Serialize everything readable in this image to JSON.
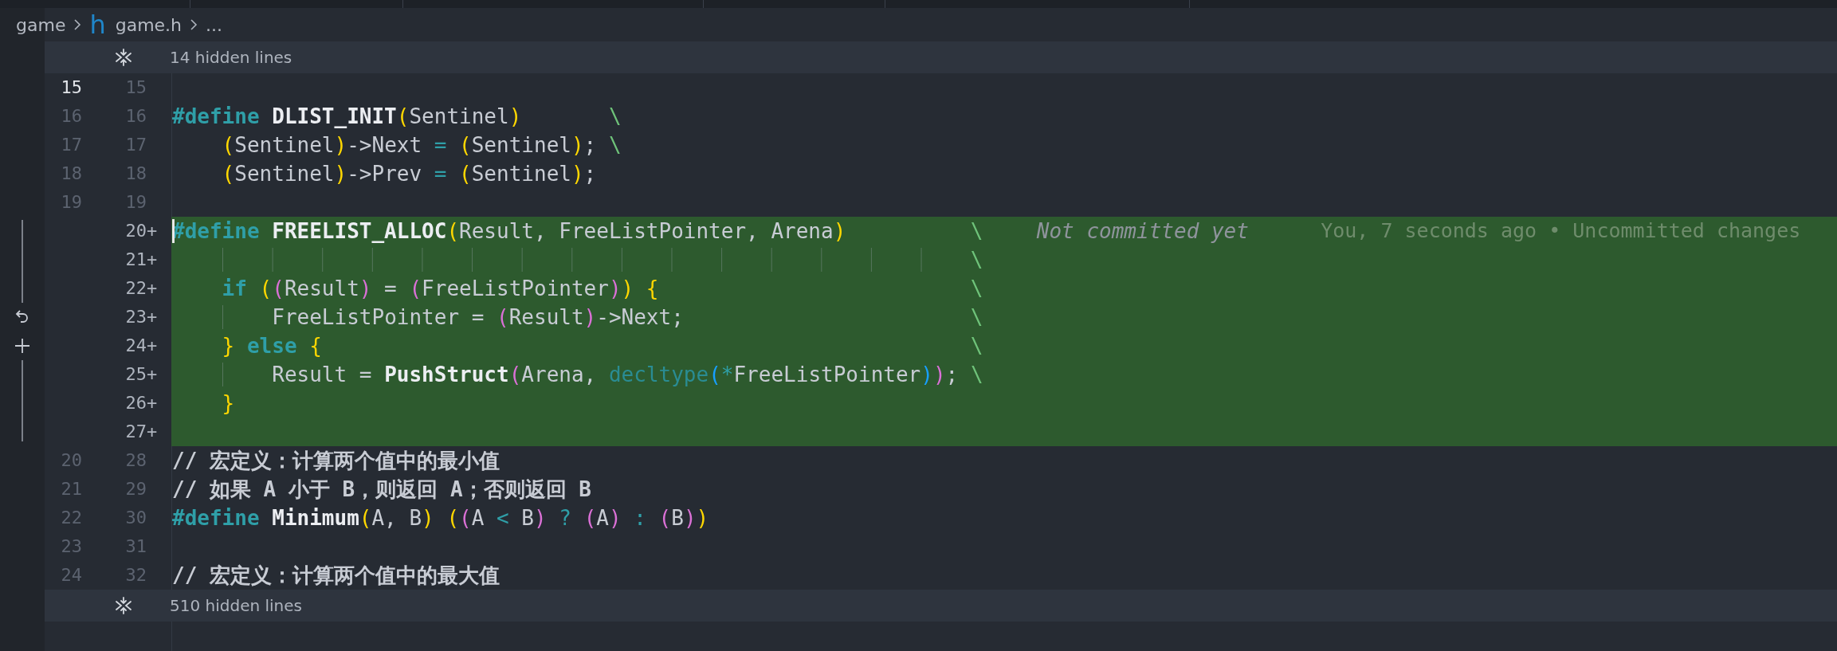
{
  "breadcrumb": {
    "items": [
      {
        "kind": "folder",
        "label": "game"
      },
      {
        "kind": "file",
        "icon": "h",
        "label": "game.h"
      },
      {
        "kind": "more",
        "label": "..."
      }
    ]
  },
  "editor": {
    "rows": [
      {
        "kind": "fold",
        "label": "14 hidden lines"
      },
      {
        "kind": "line",
        "old": "15",
        "new": "15",
        "active": true,
        "added": false,
        "tokens": []
      },
      {
        "kind": "line",
        "old": "16",
        "new": "16",
        "active": false,
        "added": false,
        "tokens": [
          {
            "kind": "kw",
            "text": "#define "
          },
          {
            "kind": "macro",
            "text": "DLIST_INIT"
          },
          {
            "kind": "b1",
            "text": "("
          },
          {
            "kind": "text",
            "text": "Sentinel"
          },
          {
            "kind": "b1",
            "text": ")"
          },
          {
            "kind": "cont",
            "text": "       \\"
          }
        ]
      },
      {
        "kind": "line",
        "old": "17",
        "new": "17",
        "active": false,
        "added": false,
        "tokens": [
          {
            "kind": "b1",
            "text": "    ("
          },
          {
            "kind": "text",
            "text": "Sentinel"
          },
          {
            "kind": "b1",
            "text": ")"
          },
          {
            "kind": "text",
            "text": "->Next "
          },
          {
            "kind": "op",
            "text": "= "
          },
          {
            "kind": "b1",
            "text": "("
          },
          {
            "kind": "text",
            "text": "Sentinel"
          },
          {
            "kind": "b1",
            "text": ")"
          },
          {
            "kind": "text",
            "text": "; "
          },
          {
            "kind": "cont",
            "text": "\\"
          }
        ]
      },
      {
        "kind": "line",
        "old": "18",
        "new": "18",
        "active": false,
        "added": false,
        "tokens": [
          {
            "kind": "b1",
            "text": "    ("
          },
          {
            "kind": "text",
            "text": "Sentinel"
          },
          {
            "kind": "b1",
            "text": ")"
          },
          {
            "kind": "text",
            "text": "->Prev "
          },
          {
            "kind": "op",
            "text": "= "
          },
          {
            "kind": "b1",
            "text": "("
          },
          {
            "kind": "text",
            "text": "Sentinel"
          },
          {
            "kind": "b1",
            "text": ")"
          },
          {
            "kind": "text",
            "text": ";"
          }
        ]
      },
      {
        "kind": "line",
        "old": "19",
        "new": "19",
        "active": false,
        "added": false,
        "tokens": []
      },
      {
        "kind": "line",
        "new": "20",
        "marker": "+",
        "added": true,
        "cursor": true,
        "tokens": [
          {
            "kind": "kw",
            "text": "#define "
          },
          {
            "kind": "macro",
            "text": "FREELIST_ALLOC"
          },
          {
            "kind": "b1",
            "text": "("
          },
          {
            "kind": "text",
            "text": "Result, FreeListPointer, Arena"
          },
          {
            "kind": "b1",
            "text": ")"
          },
          {
            "kind": "cont",
            "text": "          \\"
          }
        ],
        "blame": {
          "message": "Not committed yet",
          "detail": "You, 7 seconds ago • Uncommitted changes"
        }
      },
      {
        "kind": "line",
        "new": "21",
        "marker": "+",
        "added": true,
        "tokens": [
          {
            "kind": "cont",
            "text": "                                                                \\"
          }
        ]
      },
      {
        "kind": "line",
        "new": "22",
        "marker": "+",
        "added": true,
        "tokens": [
          {
            "kind": "kw",
            "text": "    if "
          },
          {
            "kind": "b1",
            "text": "("
          },
          {
            "kind": "b2",
            "text": "("
          },
          {
            "kind": "text",
            "text": "Result"
          },
          {
            "kind": "b2",
            "text": ")"
          },
          {
            "kind": "text",
            "text": " = "
          },
          {
            "kind": "b2",
            "text": "("
          },
          {
            "kind": "text",
            "text": "FreeListPointer"
          },
          {
            "kind": "b2",
            "text": ")"
          },
          {
            "kind": "b1",
            "text": ") {"
          },
          {
            "kind": "cont",
            "text": "                         \\"
          }
        ]
      },
      {
        "kind": "line",
        "new": "23",
        "marker": "+",
        "added": true,
        "tokens": [
          {
            "kind": "text",
            "text": "        FreeListPointer = "
          },
          {
            "kind": "b2",
            "text": "("
          },
          {
            "kind": "text",
            "text": "Result"
          },
          {
            "kind": "b2",
            "text": ")"
          },
          {
            "kind": "text",
            "text": "->Next;"
          },
          {
            "kind": "cont",
            "text": "                       \\"
          }
        ]
      },
      {
        "kind": "line",
        "new": "24",
        "marker": "+",
        "added": true,
        "tokens": [
          {
            "kind": "b1",
            "text": "    } "
          },
          {
            "kind": "kw",
            "text": "else "
          },
          {
            "kind": "b1",
            "text": "{"
          },
          {
            "kind": "cont",
            "text": "                                                    \\"
          }
        ]
      },
      {
        "kind": "line",
        "new": "25",
        "marker": "+",
        "added": true,
        "tokens": [
          {
            "kind": "text",
            "text": "        Result = "
          },
          {
            "kind": "macro",
            "text": "PushStruct"
          },
          {
            "kind": "b2",
            "text": "("
          },
          {
            "kind": "text",
            "text": "Arena, "
          },
          {
            "kind": "type",
            "text": "decltype"
          },
          {
            "kind": "b3",
            "text": "("
          },
          {
            "kind": "op",
            "text": "*"
          },
          {
            "kind": "text",
            "text": "FreeListPointer"
          },
          {
            "kind": "b3",
            "text": ")"
          },
          {
            "kind": "b2",
            "text": ")"
          },
          {
            "kind": "text",
            "text": "; "
          },
          {
            "kind": "cont",
            "text": "\\"
          }
        ]
      },
      {
        "kind": "line",
        "new": "26",
        "marker": "+",
        "added": true,
        "tokens": [
          {
            "kind": "b1",
            "text": "    }"
          }
        ]
      },
      {
        "kind": "line",
        "new": "27",
        "marker": "+",
        "added": true,
        "tokens": []
      },
      {
        "kind": "line",
        "old": "20",
        "new": "28",
        "active": false,
        "added": false,
        "tokens": [
          {
            "kind": "comment",
            "text": "// 宏定义：计算两个值中的最小值"
          }
        ]
      },
      {
        "kind": "line",
        "old": "21",
        "new": "29",
        "active": false,
        "added": false,
        "tokens": [
          {
            "kind": "comment",
            "text": "// 如果 A 小于 B，则返回 A；否则返回 B"
          }
        ]
      },
      {
        "kind": "line",
        "old": "22",
        "new": "30",
        "active": false,
        "added": false,
        "tokens": [
          {
            "kind": "kw",
            "text": "#define "
          },
          {
            "kind": "macro",
            "text": "Minimum"
          },
          {
            "kind": "b1",
            "text": "("
          },
          {
            "kind": "text",
            "text": "A, B"
          },
          {
            "kind": "b1",
            "text": ") ("
          },
          {
            "kind": "b2",
            "text": "("
          },
          {
            "kind": "text",
            "text": "A "
          },
          {
            "kind": "op",
            "text": "<"
          },
          {
            "kind": "text",
            "text": " B"
          },
          {
            "kind": "b2",
            "text": ") "
          },
          {
            "kind": "op",
            "text": "? "
          },
          {
            "kind": "b2",
            "text": "("
          },
          {
            "kind": "text",
            "text": "A"
          },
          {
            "kind": "b2",
            "text": ") "
          },
          {
            "kind": "op",
            "text": ": "
          },
          {
            "kind": "b2",
            "text": "("
          },
          {
            "kind": "text",
            "text": "B"
          },
          {
            "kind": "b2",
            "text": ")"
          },
          {
            "kind": "b1",
            "text": ")"
          }
        ]
      },
      {
        "kind": "line",
        "old": "23",
        "new": "31",
        "active": false,
        "added": false,
        "tokens": []
      },
      {
        "kind": "line",
        "old": "24",
        "new": "32",
        "active": false,
        "added": false,
        "tokens": [
          {
            "kind": "comment",
            "text": "// 宏定义：计算两个值中的最大值"
          }
        ]
      },
      {
        "kind": "fold",
        "label": "510 hidden lines"
      }
    ]
  }
}
